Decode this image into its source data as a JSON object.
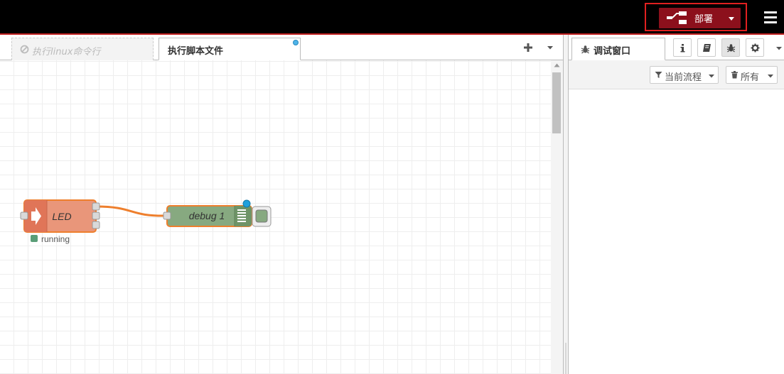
{
  "header": {
    "deploy_label": "部署",
    "colors": {
      "bar": "#000000",
      "deploy": "#8c101c",
      "highlight": "#e02020"
    }
  },
  "workspace": {
    "tabs": [
      {
        "label": "执行linux命令行",
        "state": "disabled"
      },
      {
        "label": "执行脚本文件",
        "state": "active",
        "changed": true
      }
    ],
    "nodes": [
      {
        "name": "LED",
        "type": "inject",
        "color": "#e9967a",
        "status": "running"
      },
      {
        "name": "debug 1",
        "type": "debug",
        "color": "#87a980",
        "changed": true
      }
    ]
  },
  "sidebar": {
    "active_tab": "调试窗口",
    "buttons": [
      "info-icon",
      "book-icon",
      "bug-icon",
      "gear-icon"
    ],
    "filters": {
      "flow_label": "当前流程",
      "clear_label": "所有"
    }
  }
}
